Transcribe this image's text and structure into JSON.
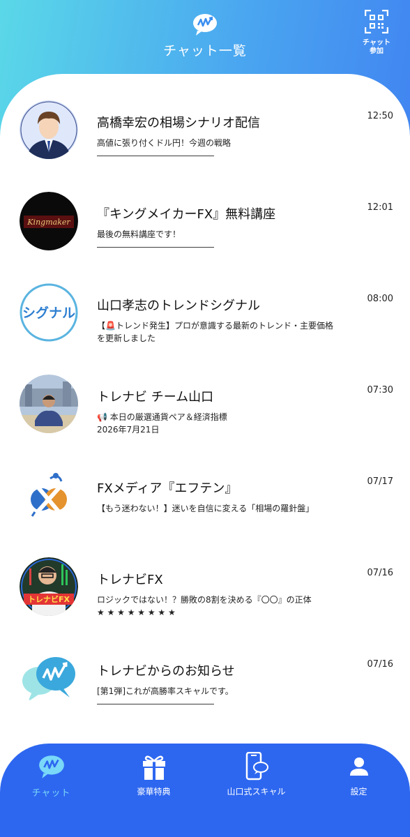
{
  "header": {
    "title": "チャット一覧",
    "qr_label_line1": "チャット",
    "qr_label_line2": "参加"
  },
  "chats": [
    {
      "name": "高橋幸宏の相場シナリオ配信",
      "time": "12:50",
      "preview": "高値に張り付くドル円！今週の戦略",
      "preview2": "――――――――――――――",
      "avatar": "person-illustration-icon"
    },
    {
      "name": "『キングメイカーFX』無料講座",
      "time": "12:01",
      "preview": "最後の無料講座です！",
      "preview2": "――――――――――――――",
      "avatar": "kingmaker-logo-icon",
      "avatar_text": "Kingmaker"
    },
    {
      "name": "山口孝志のトレンドシグナル",
      "time": "08:00",
      "preview": "【🚨トレンド発生】プロが意識する最新のトレンド・主要価格",
      "preview2": "を更新しました",
      "avatar": "signal-logo-icon",
      "avatar_text": "シグナル"
    },
    {
      "name": "トレナビ チーム山口",
      "time": "07:30",
      "preview": "📢 本日の厳選通貨ペア＆経済指標",
      "preview2": "2026年7月21日",
      "avatar": "person-photo-icon"
    },
    {
      "name": "FXメディア『エフテン』",
      "time": "07/17",
      "preview": "【もう迷わない！】迷いを自信に変える「相場の羅針盤」",
      "preview2": "",
      "avatar": "ften-logo-icon"
    },
    {
      "name": "トレナビFX",
      "time": "07/16",
      "preview": "ロジックではない！？勝敗の8割を決める『〇〇』の正体",
      "preview2": "★ ★ ★ ★ ★ ★ ★ ★",
      "avatar": "torenabi-fx-logo-icon",
      "avatar_text": "トレナビFX"
    },
    {
      "name": "トレナビからのお知らせ",
      "time": "07/16",
      "preview": "[第1弾]これが高勝率スキャルです。",
      "preview2": "――――――――――――――",
      "avatar": "torenabi-chat-logo-icon"
    }
  ],
  "nav": [
    {
      "label": "チャット",
      "icon": "chat-bubble-icon",
      "active": true
    },
    {
      "label": "豪華特典",
      "icon": "gift-icon",
      "active": false
    },
    {
      "label": "山口式スキャル",
      "icon": "phone-chat-icon",
      "active": false
    },
    {
      "label": "設定",
      "icon": "user-icon",
      "active": false
    }
  ],
  "colors": {
    "header_gradient_start": "#5ad8e8",
    "header_gradient_end": "#3b6ff2",
    "nav_bg": "#2d67f0",
    "nav_active": "#7ad8f8"
  }
}
